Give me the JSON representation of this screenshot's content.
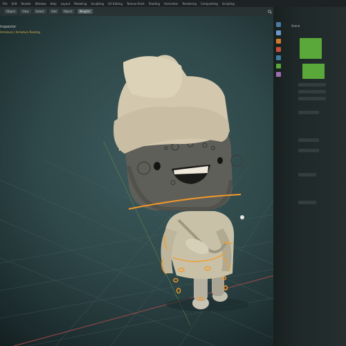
{
  "top_menu": [
    "File",
    "Edit",
    "Render",
    "Window",
    "Help",
    "Layout",
    "Modeling",
    "Sculpting",
    "UV Editing",
    "Texture Paint",
    "Shading",
    "Animation",
    "Rendering",
    "Compositing",
    "Scripting"
  ],
  "toolbar": {
    "items": [
      "Object",
      "View",
      "Select",
      "Add",
      "Object"
    ],
    "active": "Weights",
    "search_label": "Search"
  },
  "outliner": {
    "title": "Inspector",
    "subtitle": "Armature / Armature Rooting"
  },
  "properties_panel": {
    "header": "Scene",
    "accent_color": "#5aa83a"
  },
  "colors": {
    "viewport_bg": "#2e4749",
    "selection": "#f39a2a",
    "clay": "#cfc6ad"
  }
}
